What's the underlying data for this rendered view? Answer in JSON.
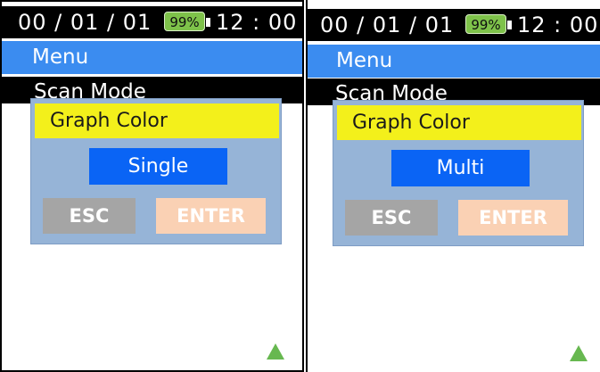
{
  "screens": [
    {
      "status_bar": {
        "date": "00 / 01 / 01",
        "battery": "99%",
        "time": "12 : 00"
      },
      "menu_title": "Menu",
      "submenu_title": "Scan Mode",
      "dialog": {
        "title": "Graph Color",
        "value": "Single",
        "esc_label": "ESC",
        "enter_label": "ENTER"
      }
    },
    {
      "status_bar": {
        "date": "00 / 01 / 01",
        "battery": "99%",
        "time": "12 : 00"
      },
      "menu_title": "Menu",
      "submenu_title": "Scan Mode",
      "dialog": {
        "title": "Graph Color",
        "value": "Multi",
        "esc_label": "ESC",
        "enter_label": "ENTER"
      }
    }
  ],
  "icons": {
    "scroll_up": "triangle-up-icon"
  },
  "colors": {
    "menu_bar": "#3b8cf0",
    "dialog_title": "#f3f01b",
    "selected_value": "#0a64f5",
    "battery": "#7ec24a",
    "scroll_arrow": "#67b850"
  }
}
